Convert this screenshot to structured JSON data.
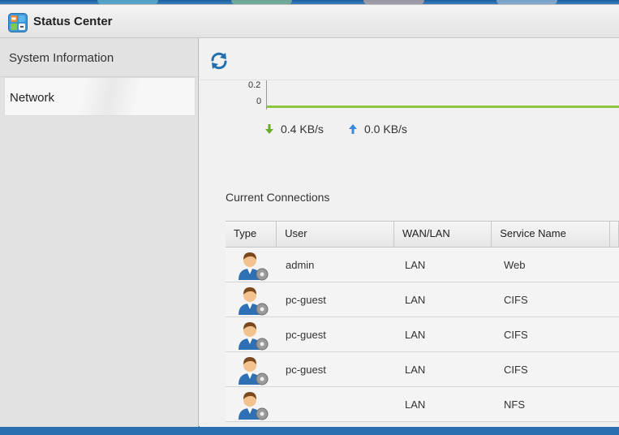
{
  "window": {
    "title": "Status Center",
    "app_icon": "status-center-icon"
  },
  "sidebar": {
    "items": [
      {
        "label": "System Information",
        "active": false
      },
      {
        "label": "Network",
        "active": true
      }
    ]
  },
  "toolbar": {
    "refresh_icon": "refresh-icon"
  },
  "chart_data": {
    "type": "line",
    "ytick_labels": [
      "0.2",
      "0"
    ],
    "series": [
      {
        "values": [
          0,
          0,
          0,
          0
        ]
      }
    ],
    "ylim": [
      0,
      0.2
    ],
    "colors": {
      "line": "#8dc63f"
    }
  },
  "speeds": {
    "download": {
      "value": "0.4 KB/s",
      "icon": "download-arrow-icon",
      "color": "#6aab2b"
    },
    "upload": {
      "value": "0.0 KB/s",
      "icon": "upload-arrow-icon",
      "color": "#3a8ad6"
    }
  },
  "connections": {
    "title": "Current Connections",
    "columns": [
      "Type",
      "User",
      "WAN/LAN",
      "Service Name"
    ],
    "rows": [
      {
        "type_icon": "user-connection-icon",
        "user": "admin",
        "wanlan": "LAN",
        "service": "Web"
      },
      {
        "type_icon": "user-connection-icon",
        "user": "pc-guest",
        "wanlan": "LAN",
        "service": "CIFS"
      },
      {
        "type_icon": "user-connection-icon",
        "user": "pc-guest",
        "wanlan": "LAN",
        "service": "CIFS"
      },
      {
        "type_icon": "user-connection-icon",
        "user": "pc-guest",
        "wanlan": "LAN",
        "service": "CIFS"
      },
      {
        "type_icon": "user-connection-icon",
        "user": "",
        "wanlan": "LAN",
        "service": "NFS"
      }
    ]
  }
}
